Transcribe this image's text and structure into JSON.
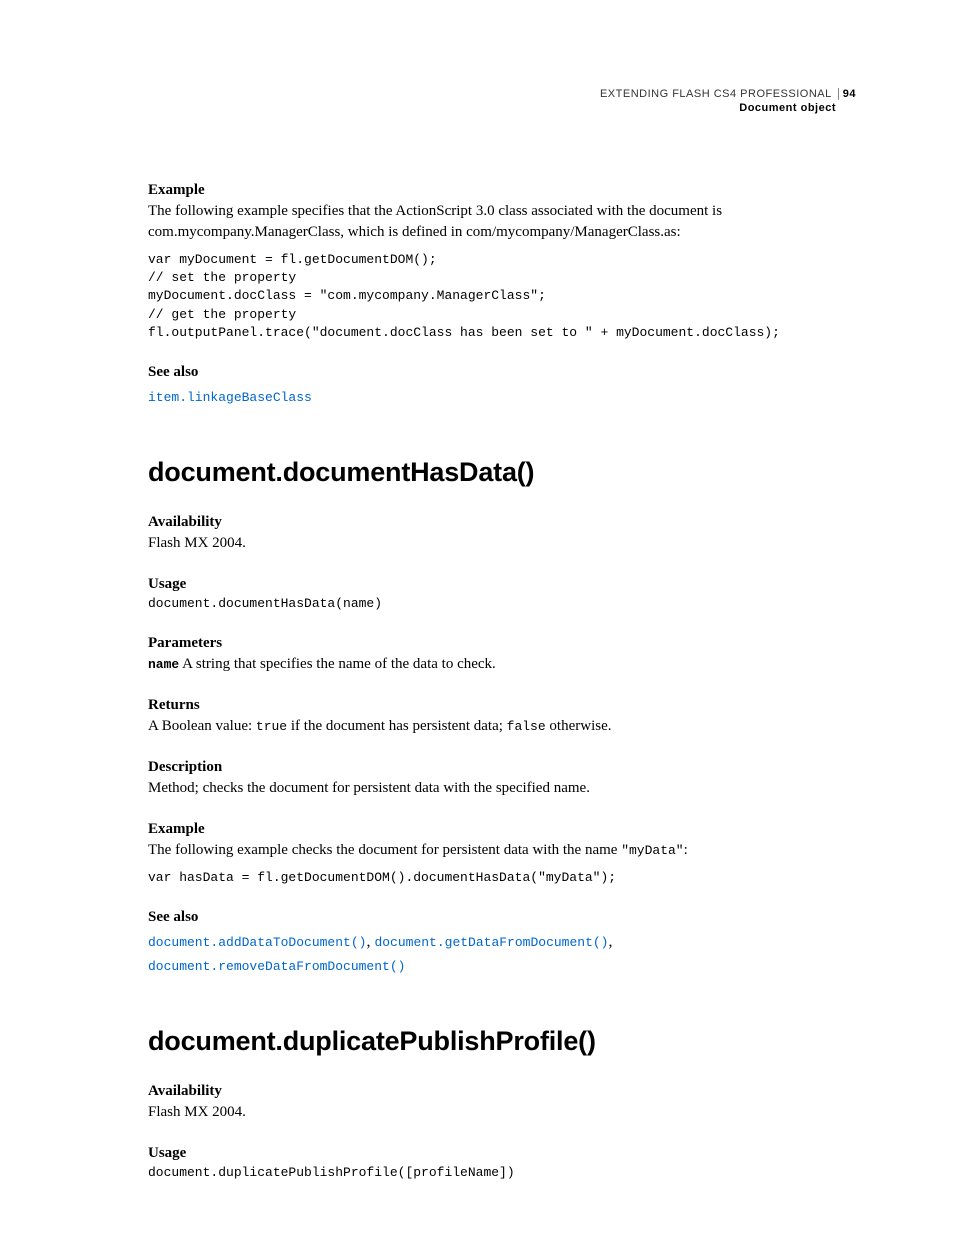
{
  "header": {
    "title": "EXTENDING FLASH CS4 PROFESSIONAL",
    "page_number": "94",
    "subtitle": "Document object"
  },
  "section1": {
    "example_label": "Example",
    "example_text": "The following example specifies that the ActionScript 3.0 class associated with the document is com.mycompany.ManagerClass, which is defined in com/mycompany/ManagerClass.as:",
    "code": "var myDocument = fl.getDocumentDOM();\n// set the property\nmyDocument.docClass = \"com.mycompany.ManagerClass\";\n// get the property\nfl.outputPanel.trace(\"document.docClass has been set to \" + myDocument.docClass);",
    "see_also_label": "See also",
    "see_also_link": "item.linkageBaseClass"
  },
  "section2": {
    "heading": "document.documentHasData()",
    "availability_label": "Availability",
    "availability_text": "Flash MX 2004.",
    "usage_label": "Usage",
    "usage_code": "document.documentHasData(name)",
    "parameters_label": "Parameters",
    "param_name": "name",
    "param_desc": "  A string that specifies the name of the data to check.",
    "returns_label": "Returns",
    "returns_prefix": "A Boolean value: ",
    "returns_true": "true",
    "returns_mid": " if the document has persistent data; ",
    "returns_false": "false",
    "returns_suffix": " otherwise.",
    "description_label": "Description",
    "description_text": "Method; checks the document for persistent data with the specified name.",
    "example_label": "Example",
    "example_prefix": "The following example checks the document for persistent data with the name ",
    "example_code_inline": "\"myData\"",
    "example_suffix": ":",
    "example_code": "var hasData = fl.getDocumentDOM().documentHasData(\"myData\");",
    "see_also_label": "See also",
    "see_also_link1": "document.addDataToDocument()",
    "see_also_sep1": ", ",
    "see_also_link2": "document.getDataFromDocument()",
    "see_also_sep2": ", ",
    "see_also_link3": "document.removeDataFromDocument()"
  },
  "section3": {
    "heading": "document.duplicatePublishProfile()",
    "availability_label": "Availability",
    "availability_text": "Flash MX 2004.",
    "usage_label": "Usage",
    "usage_code": "document.duplicatePublishProfile([profileName])"
  }
}
